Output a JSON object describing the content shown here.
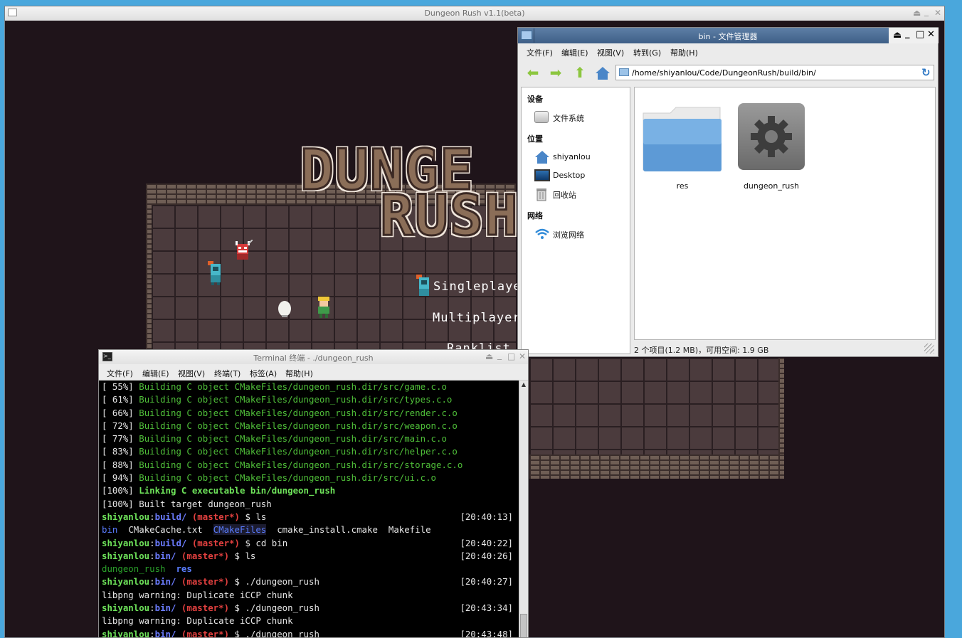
{
  "game_window": {
    "title": "Dungeon Rush v1.1(beta)",
    "controls": [
      "⏏",
      "_",
      "✕"
    ],
    "logo_line1": "DUNGE",
    "logo_line2": "RUSH",
    "menu": [
      "Singleplayer",
      "Multiplayers",
      "Ranklist"
    ]
  },
  "file_manager": {
    "title": "bin - 文件管理器",
    "menu": [
      "文件(F)",
      "编辑(E)",
      "视图(V)",
      "转到(G)",
      "帮助(H)"
    ],
    "path": "/home/shiyanlou/Code/DungeonRush/build/bin/",
    "sidebar": {
      "devices_header": "设备",
      "devices": [
        {
          "label": "文件系统",
          "icon": "drive-icon"
        }
      ],
      "places_header": "位置",
      "places": [
        {
          "label": "shiyanlou",
          "icon": "home-icon"
        },
        {
          "label": "Desktop",
          "icon": "desktop-icon"
        },
        {
          "label": "回收站",
          "icon": "trash-icon"
        }
      ],
      "network_header": "网络",
      "network": [
        {
          "label": "浏览网络",
          "icon": "wifi-icon"
        }
      ]
    },
    "files": [
      {
        "name": "res",
        "icon": "folder-icon"
      },
      {
        "name": "dungeon_rush",
        "icon": "executable-gear-icon"
      }
    ],
    "status": "2 个项目(1.2 MB)，可用空间: 1.9 GB"
  },
  "terminal": {
    "title": "Terminal 终端 - ./dungeon_rush",
    "menu": [
      "文件(F)",
      "编辑(E)",
      "视图(V)",
      "终端(T)",
      "标签(A)",
      "帮助(H)"
    ],
    "build_lines": [
      {
        "pct": "[ 55%]",
        "msg": "Building C object CMakeFiles/dungeon_rush.dir/src/game.c.o"
      },
      {
        "pct": "[ 61%]",
        "msg": "Building C object CMakeFiles/dungeon_rush.dir/src/types.c.o"
      },
      {
        "pct": "[ 66%]",
        "msg": "Building C object CMakeFiles/dungeon_rush.dir/src/render.c.o"
      },
      {
        "pct": "[ 72%]",
        "msg": "Building C object CMakeFiles/dungeon_rush.dir/src/weapon.c.o"
      },
      {
        "pct": "[ 77%]",
        "msg": "Building C object CMakeFiles/dungeon_rush.dir/src/main.c.o"
      },
      {
        "pct": "[ 83%]",
        "msg": "Building C object CMakeFiles/dungeon_rush.dir/src/helper.c.o"
      },
      {
        "pct": "[ 88%]",
        "msg": "Building C object CMakeFiles/dungeon_rush.dir/src/storage.c.o"
      },
      {
        "pct": "[ 94%]",
        "msg": "Building C object CMakeFiles/dungeon_rush.dir/src/ui.c.o"
      }
    ],
    "link_pct": "[100%]",
    "link_msg": "Linking C executable bin/dungeon_rush",
    "built_line": "[100%] Built target dungeon_rush",
    "user": "shiyanlou",
    "branch": "(master*)",
    "prompt_symbol": "$",
    "sessions": [
      {
        "path": "build/",
        "cmd": "ls",
        "time": "[20:40:13]"
      },
      {
        "path": "build/",
        "cmd": "cd bin",
        "time": "[20:40:22]"
      },
      {
        "path": "bin/",
        "cmd": "ls",
        "time": "[20:40:26]"
      },
      {
        "path": "bin/",
        "cmd": "./dungeon_rush",
        "time": "[20:40:27]"
      },
      {
        "path": "bin/",
        "cmd": "./dungeon_rush",
        "time": "[20:43:34]"
      },
      {
        "path": "bin/",
        "cmd": "./dungeon_rush",
        "time": "[20:43:48]"
      }
    ],
    "ls_build": [
      "bin",
      "CMakeCache.txt",
      "CMakeFiles",
      "cmake_install.cmake",
      "Makefile"
    ],
    "ls_bin": [
      "dungeon_rush",
      "res"
    ],
    "warning": "libpng warning: Duplicate iCCP chunk"
  }
}
